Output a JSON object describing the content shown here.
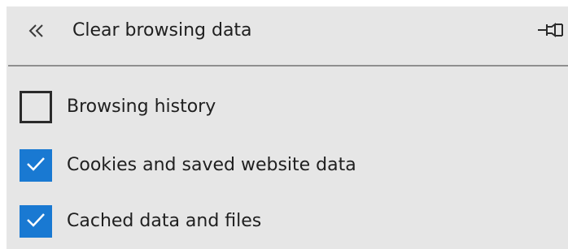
{
  "panel": {
    "title": "Clear browsing data",
    "back_icon": "double-chevron-left-icon",
    "pin_icon": "pin-icon",
    "colors": {
      "background": "#e6e6e6",
      "accent": "#1979d2",
      "text": "#1f1f1f",
      "divider": "#8f8f8f"
    }
  },
  "options": [
    {
      "label": "Browsing history",
      "checked": false
    },
    {
      "label": "Cookies and saved website data",
      "checked": true
    },
    {
      "label": "Cached data and files",
      "checked": true
    }
  ]
}
